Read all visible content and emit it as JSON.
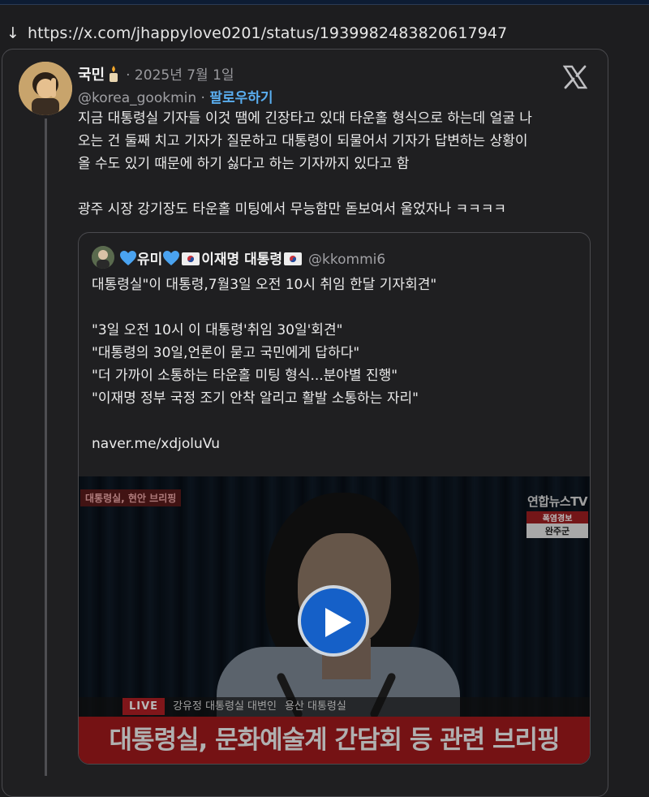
{
  "url_line": {
    "arrow": "↓",
    "url": "https://x.com/jhappylove0201/status/1939982483820617947"
  },
  "tweet": {
    "author_name": "국민",
    "date": "· 2025년 7월 1일",
    "handle": "@korea_gookmin",
    "separator": " · ",
    "follow_label": "팔로우하기",
    "text_lines": [
      "지금 대통령실 기자들 이것 땜에 긴장타고 있대 타운홀 형식으로 하는데 얼굴 나",
      "오는 건 둘째 치고 기자가 질문하고 대통령이 되물어서 기자가 답변하는 상황이",
      "올 수도 있기 때문에 하기 싫다고 하는 기자까지 있다고 함",
      "광주 시장 강기장도 타운홀 미팅에서 무능함만 돋보여서 울었자나 ㅋㅋㅋㅋ"
    ]
  },
  "quote": {
    "name_prefix": "유미",
    "name_suffix": "이재명 대통령",
    "handle": "@kkommi6",
    "lines": [
      "대통령실\"이 대통령,7월3일 오전 10시 취임 한달 기자회견\"",
      "\"3일 오전 10시 이 대통령'취임 30일'회견\"",
      "\"대통령의 30일,언론이 묻고 국민에게 답하다\"",
      "\"더 가까이 소통하는 타운홀 미팅 형식...분야별 진행\"",
      "\"이재명 정부 국정 조기 안착 알리고 활발 소통하는 자리\"",
      "naver.me/xdjoluVu"
    ]
  },
  "media": {
    "tag_topleft": "대통령실, 현안 브리핑",
    "broadcaster": "연합뉴스TV",
    "alert": "폭염경보",
    "region": "완주군",
    "live": "LIVE",
    "speaker": "강유정 대통령실 대변인",
    "location": "용산 대통령실",
    "headline": "대통령실, 문화예술계 간담회 등 관련 브리핑"
  },
  "icons": {
    "x_logo": "x-logo-icon",
    "play": "play-icon",
    "candle": "candle-icon",
    "heart": "blue-heart-icon",
    "flag": "korea-flag-icon"
  },
  "colors": {
    "link_blue": "#5aaef0",
    "background": "#1f1f21",
    "play_blue": "#1560c8",
    "news_red": "#a3191d"
  }
}
